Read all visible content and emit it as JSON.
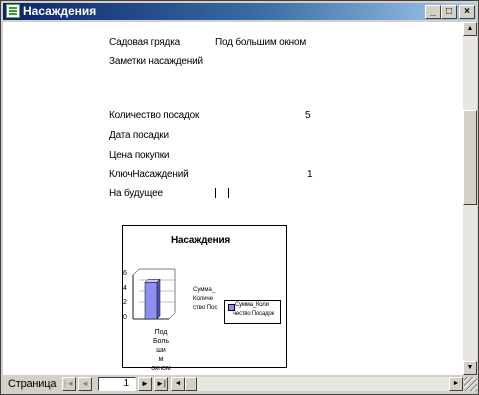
{
  "window": {
    "title": "Насаждения",
    "controls": [
      "_",
      "□",
      "×"
    ]
  },
  "form": {
    "fields": [
      {
        "label": "Садовая грядка",
        "value": "Под большим окном"
      },
      {
        "label": "Заметки насаждений",
        "value": ""
      },
      {
        "label": "Количество посадок",
        "value": "5"
      },
      {
        "label": "Дата посадки",
        "value": ""
      },
      {
        "label": "Цена покупки",
        "value": ""
      },
      {
        "label": "КлючНасаждений",
        "value": "1"
      },
      {
        "label": "На будущее",
        "value": ""
      }
    ]
  },
  "chart": {
    "title": "Насаждения",
    "category": "Под Боль ши м окном",
    "category_lines": [
      "Под",
      "Боль",
      "ши",
      "м",
      "окном"
    ],
    "side_text_lines": [
      "Сумма_",
      "Количе",
      "ство Пос"
    ],
    "legend_lines": [
      "Сумма_Коли",
      "чество Посадок"
    ],
    "y_ticks": [
      "6",
      "4",
      "2",
      "0"
    ],
    "chart_data": {
      "type": "bar",
      "categories": [
        "Под большим окном"
      ],
      "series": [
        {
          "name": "Сумма_Количество Посадок",
          "values": [
            5
          ]
        }
      ],
      "ylim": [
        0,
        6
      ]
    }
  },
  "statusbar": {
    "page_label": "Страница",
    "page_number": "1",
    "nav": {
      "first": "|◄",
      "prev": "◄",
      "next": "►",
      "last": "►|"
    }
  },
  "colors": {
    "title_start": "#0a246a",
    "title_end": "#a6caf0",
    "bar": "#8f8ff0",
    "panel": "#d4d0c8"
  }
}
